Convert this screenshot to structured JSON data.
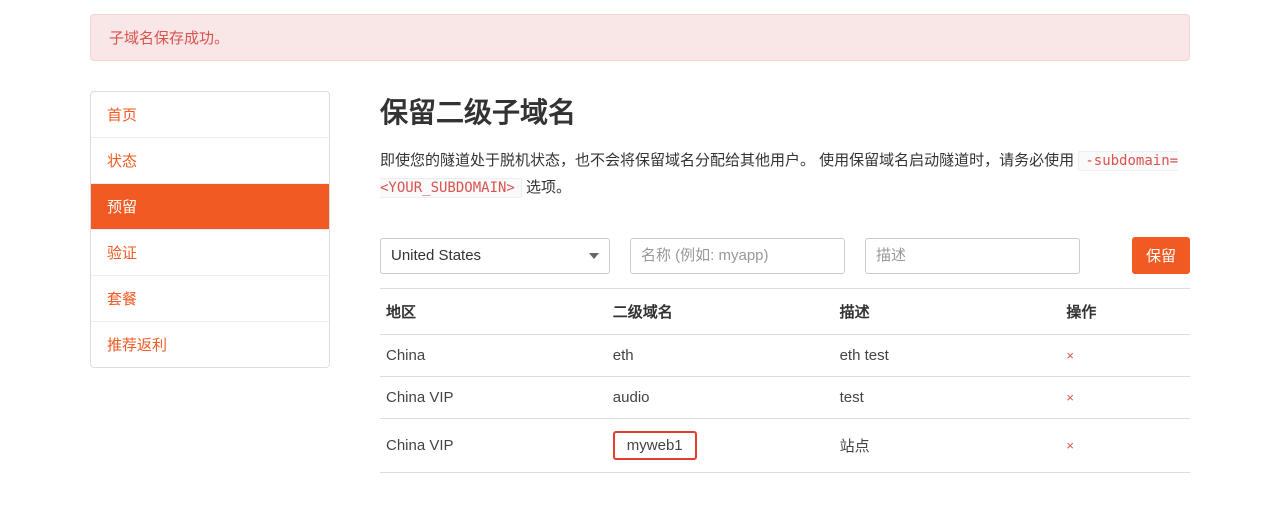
{
  "alert": {
    "message": "子域名保存成功。"
  },
  "sidebar": {
    "items": [
      {
        "label": "首页"
      },
      {
        "label": "状态"
      },
      {
        "label": "预留"
      },
      {
        "label": "验证"
      },
      {
        "label": "套餐"
      },
      {
        "label": "推荐返利"
      }
    ],
    "active_index": 2
  },
  "main": {
    "title": "保留二级子域名",
    "desc_part1": "即使您的隧道处于脱机状态，也不会将保留域名分配给其他用户。 使用保留域名启动隧道时，请务必使用 ",
    "desc_code": "-subdomain=<YOUR_SUBDOMAIN>",
    "desc_part2": " 选项。",
    "form": {
      "region_selected": "United States",
      "name_placeholder": "名称 (例如: myapp)",
      "desc_placeholder": "描述",
      "submit_label": "保留"
    },
    "table": {
      "headers": {
        "region": "地区",
        "subdomain": "二级域名",
        "desc": "描述",
        "op": "操作"
      },
      "rows": [
        {
          "region": "China",
          "subdomain": "eth",
          "desc": "eth test",
          "highlight": false
        },
        {
          "region": "China VIP",
          "subdomain": "audio",
          "desc": "test",
          "highlight": false
        },
        {
          "region": "China VIP",
          "subdomain": "myweb1",
          "desc": "站点",
          "highlight": true
        }
      ],
      "delete_glyph": "×"
    }
  }
}
